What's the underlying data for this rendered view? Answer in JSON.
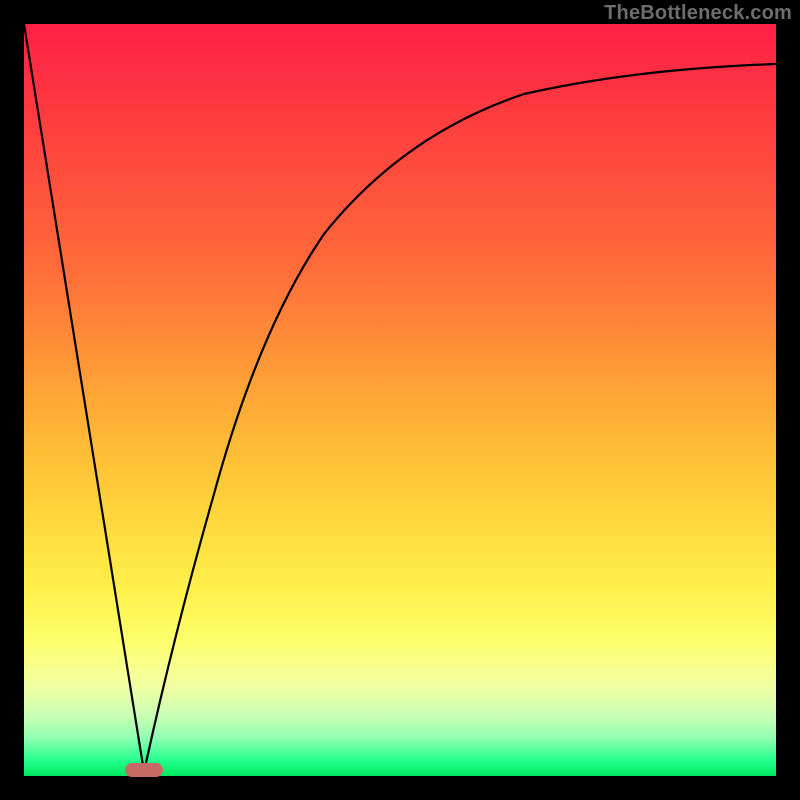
{
  "watermark": "TheBottleneck.com",
  "colors": {
    "frame": "#000000",
    "curve": "#000000",
    "marker": "#c66a65",
    "gradient_top": "#ff1f46",
    "gradient_bottom": "#00e85e"
  },
  "chart_data": {
    "type": "line",
    "title": "",
    "xlabel": "",
    "ylabel": "",
    "xlim": [
      0,
      100
    ],
    "ylim": [
      0,
      100
    ],
    "grid": false,
    "legend": false,
    "series": [
      {
        "name": "left-slope",
        "x": [
          0,
          16
        ],
        "values": [
          100,
          0
        ]
      },
      {
        "name": "right-curve",
        "x": [
          16,
          20,
          25,
          30,
          35,
          40,
          50,
          60,
          70,
          80,
          90,
          100
        ],
        "values": [
          0,
          18,
          38,
          52,
          62,
          70,
          80,
          85.5,
          89,
          91.5,
          93.2,
          94.5
        ]
      }
    ],
    "marker": {
      "x_center": 16,
      "width_pct": 5,
      "color": "#c66a65"
    }
  }
}
